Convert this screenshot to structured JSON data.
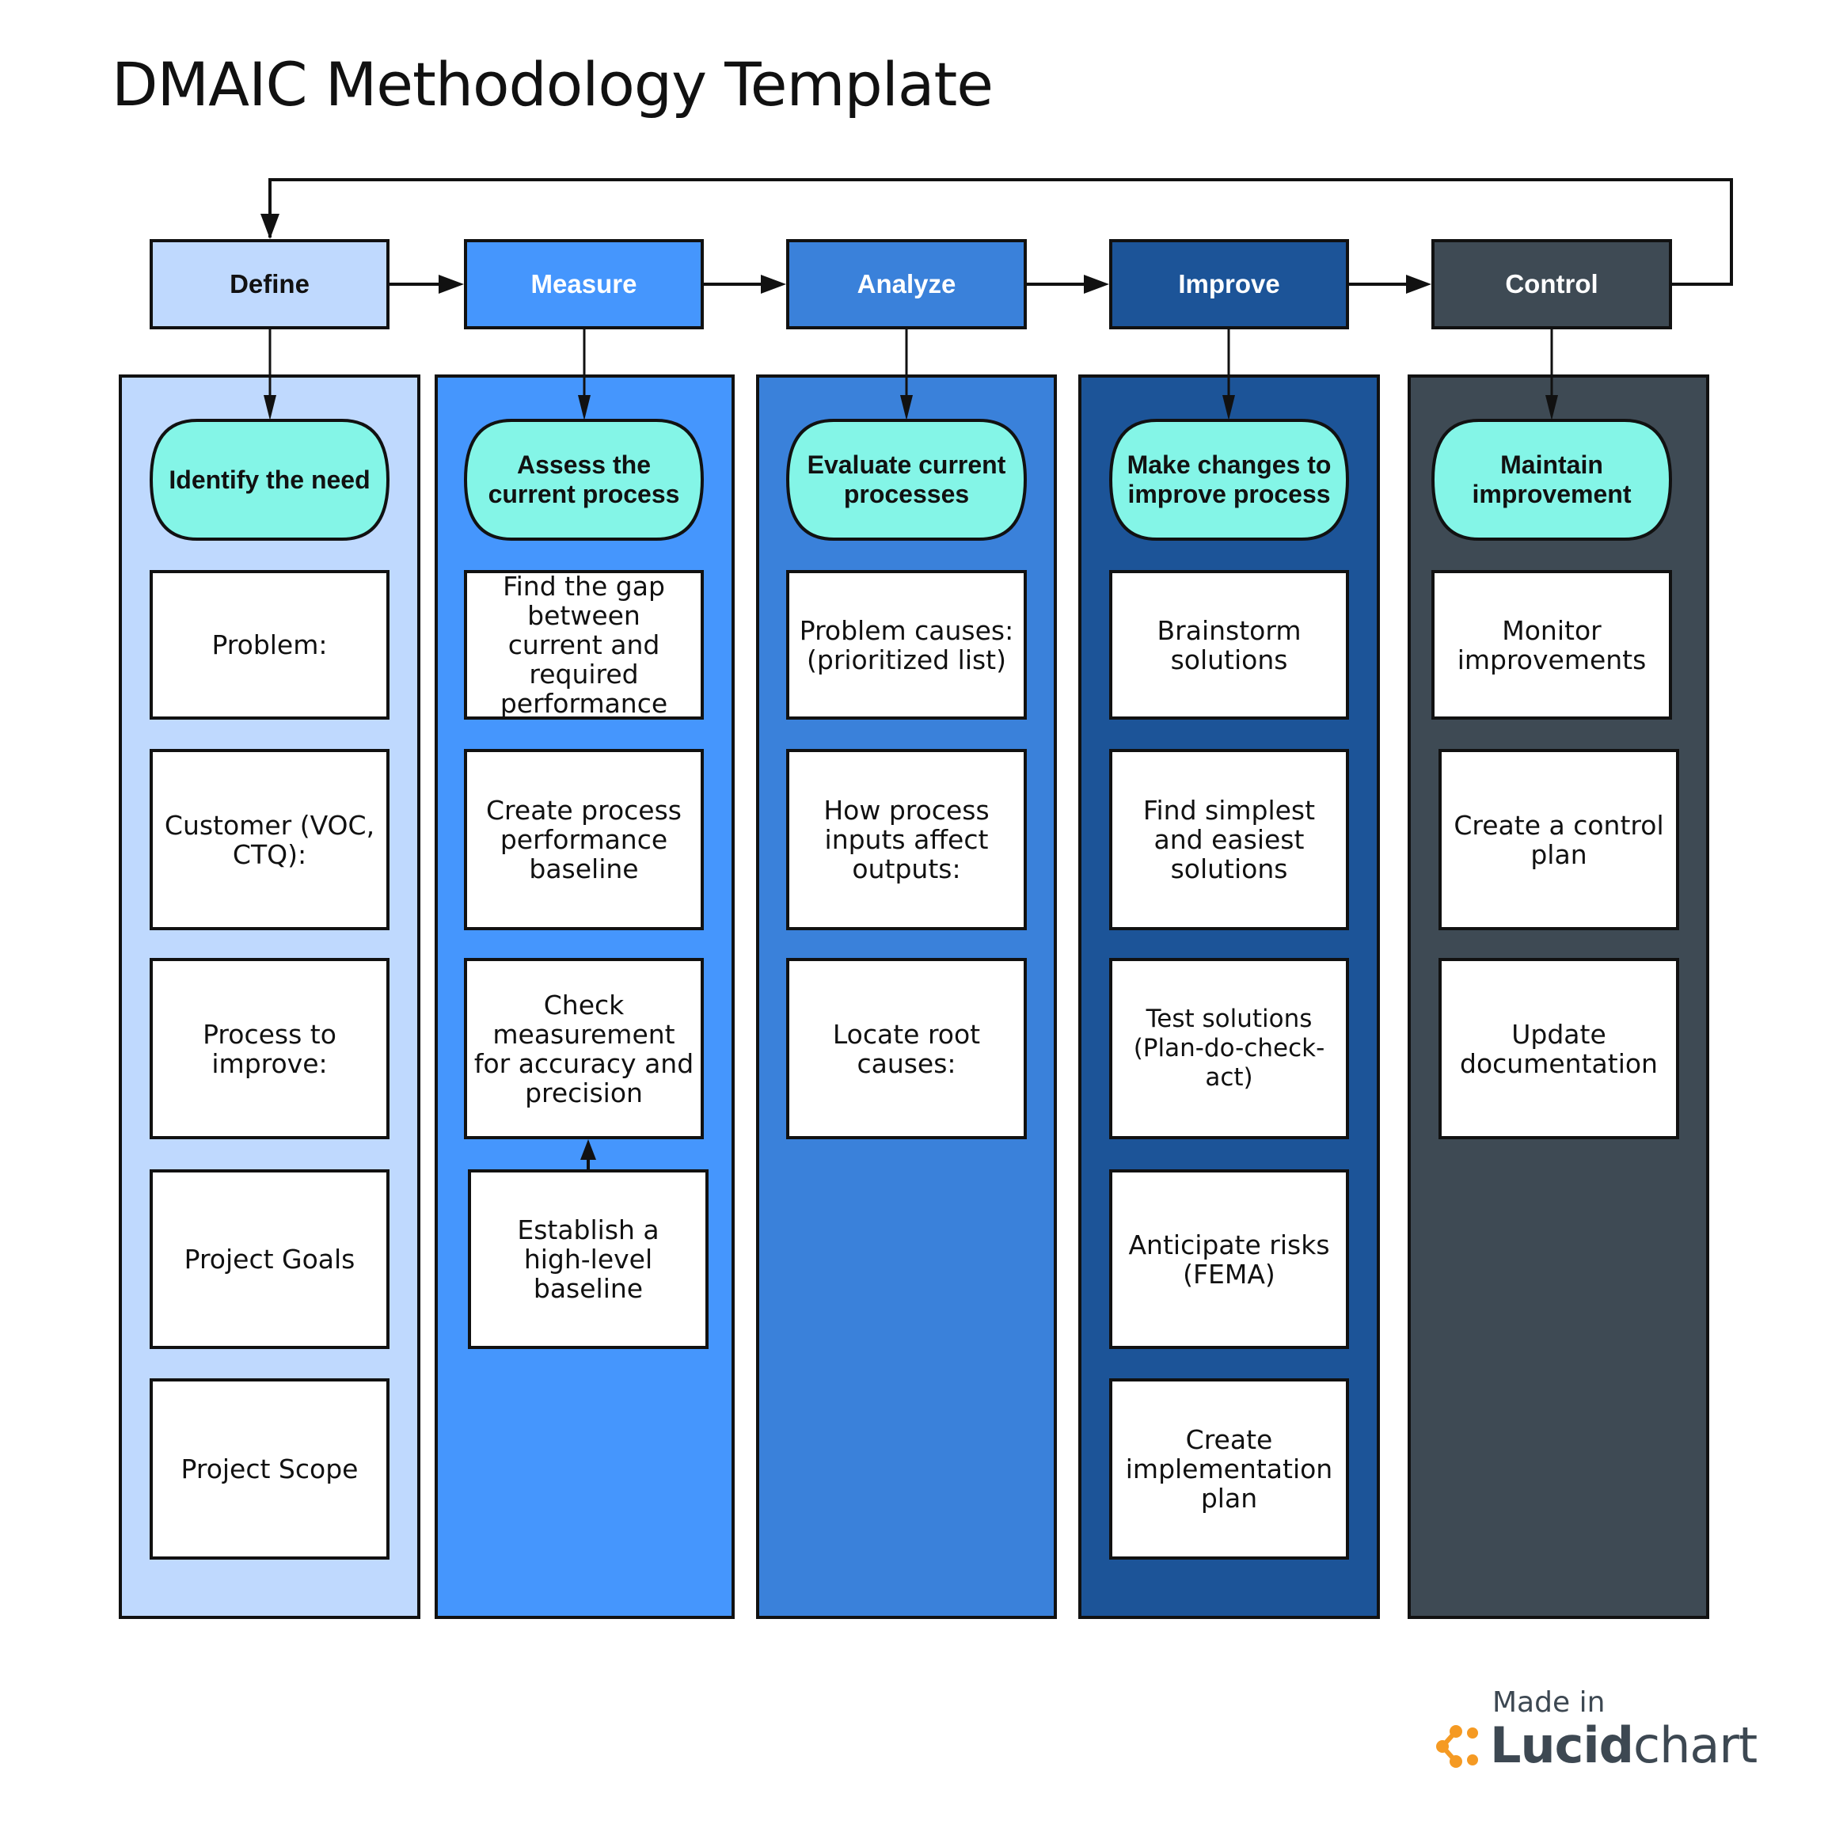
{
  "title": "DMAIC Methodology Template",
  "colors": {
    "define": "#bfd9fe",
    "measure": "#4596fd",
    "analyze": "#3a81da",
    "improve": "#1c5498",
    "control": "#3e4a54",
    "pill": "#84f5e7",
    "box": "#ffffff",
    "stroke": "#111111",
    "logo_orange": "#f59a23"
  },
  "phases": [
    {
      "name": "Define",
      "goal": "Identify the need",
      "steps": [
        "Problem:",
        "Customer (VOC, CTQ):",
        "Process to improve:",
        "Project Goals",
        "Project Scope"
      ]
    },
    {
      "name": "Measure",
      "goal": "Assess the current process",
      "steps": [
        "Find the gap between current and required performance",
        "Create process performance baseline",
        "Check measurement for accuracy and precision",
        "Establish a high-level baseline"
      ]
    },
    {
      "name": "Analyze",
      "goal": "Evaluate current processes",
      "steps": [
        "Problem causes: (prioritized list)",
        "How process inputs affect outputs:",
        "Locate root causes:"
      ]
    },
    {
      "name": "Improve",
      "goal": "Make changes to improve process",
      "steps": [
        "Brainstorm solutions",
        "Find simplest and easiest solutions",
        "Test solutions (Plan-do-check-act)",
        "Anticipate risks (FEMA)",
        "Create implementation plan"
      ]
    },
    {
      "name": "Control",
      "goal": "Maintain improvement",
      "steps": [
        "Monitor improvements",
        "Create a control plan",
        "Update documentation"
      ]
    }
  ],
  "footer": {
    "made_in": "Made in",
    "brand_bold": "Lucid",
    "brand_light": "chart"
  }
}
